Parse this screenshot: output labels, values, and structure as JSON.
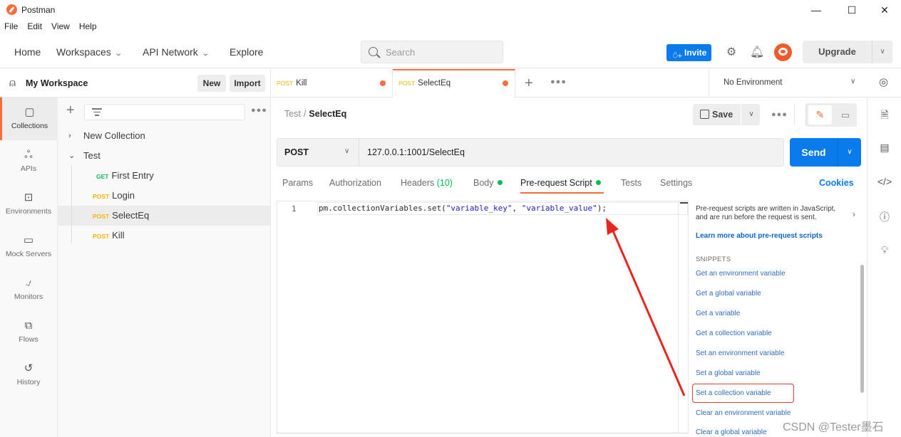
{
  "window": {
    "title": "Postman",
    "controls": {
      "minimize": "—",
      "maximize": "☐",
      "close": "✕"
    }
  },
  "menu": [
    "File",
    "Edit",
    "View",
    "Help"
  ],
  "header": {
    "nav": [
      {
        "label": "Home",
        "has_dropdown": false
      },
      {
        "label": "Workspaces",
        "has_dropdown": true
      },
      {
        "label": "API Network",
        "has_dropdown": true
      },
      {
        "label": "Explore",
        "has_dropdown": false
      }
    ],
    "search_placeholder": "Search",
    "invite_label": "Invite",
    "upgrade_label": "Upgrade",
    "icons": {
      "settings": "⚙",
      "notifications": "🔔"
    }
  },
  "workspace": {
    "name": "My Workspace",
    "new_label": "New",
    "import_label": "Import"
  },
  "rail": [
    {
      "label": "Collections",
      "icon": "collections-icon",
      "glyph": "▢",
      "active": true
    },
    {
      "label": "APIs",
      "icon": "apis-icon",
      "glyph": "ஃ",
      "active": false
    },
    {
      "label": "Environments",
      "icon": "environments-icon",
      "glyph": "⊡",
      "active": false
    },
    {
      "label": "Mock Servers",
      "icon": "mock-servers-icon",
      "glyph": "▭",
      "active": false
    },
    {
      "label": "Monitors",
      "icon": "monitors-icon",
      "glyph": "⍻",
      "active": false
    },
    {
      "label": "Flows",
      "icon": "flows-icon",
      "glyph": "⧉",
      "active": false
    },
    {
      "label": "History",
      "icon": "history-icon",
      "glyph": "↺",
      "active": false
    }
  ],
  "collections": [
    {
      "type": "collection",
      "name": "New Collection",
      "expanded": false
    },
    {
      "type": "collection",
      "name": "Test",
      "expanded": true
    },
    {
      "type": "request",
      "method": "GET",
      "name": "First Entry"
    },
    {
      "type": "request",
      "method": "POST",
      "name": "Login"
    },
    {
      "type": "request",
      "method": "POST",
      "name": "SelectEq",
      "selected": true
    },
    {
      "type": "request",
      "method": "POST",
      "name": "Kill"
    }
  ],
  "tabs": [
    {
      "method": "POST",
      "name": "Kill",
      "unsaved": true,
      "active": false
    },
    {
      "method": "POST",
      "name": "SelectEq",
      "unsaved": true,
      "active": true
    }
  ],
  "environment": {
    "selected": "No Environment"
  },
  "breadcrumb": {
    "parent": "Test",
    "separator": "/",
    "current": "SelectEq"
  },
  "toolbar": {
    "save_label": "Save"
  },
  "request": {
    "method": "POST",
    "url": "127.0.0.1:1001/SelectEq",
    "send_label": "Send"
  },
  "request_tabs": [
    {
      "label": "Params"
    },
    {
      "label": "Authorization"
    },
    {
      "label": "Headers",
      "count": "(10)"
    },
    {
      "label": "Body",
      "indicator": true
    },
    {
      "label": "Pre-request Script",
      "indicator": true,
      "active": true
    },
    {
      "label": "Tests"
    },
    {
      "label": "Settings"
    }
  ],
  "cookies_label": "Cookies",
  "editor": {
    "lines": [
      {
        "number": "1",
        "code_prefix": "pm.collectionVariables.set(",
        "arg1": "\"variable_key\"",
        "sep": ", ",
        "arg2": "\"variable_value\"",
        "code_suffix": ");"
      }
    ]
  },
  "snippets_panel": {
    "description": "Pre-request scripts are written in JavaScript, and are run before the request is sent.",
    "learn_more": "Learn more about pre-request scripts",
    "heading": "SNIPPETS",
    "items": [
      "Get an environment variable",
      "Get a global variable",
      "Get a variable",
      "Get a collection variable",
      "Set an environment variable",
      "Set a global variable",
      "Set a collection variable",
      "Clear an environment variable",
      "Clear a global variable"
    ],
    "highlighted": "Set a collection variable"
  },
  "annotation": {
    "arrow_color": "#e8261f",
    "highlight_color": "#e53935"
  },
  "watermark": "CSDN @Tester墨石",
  "colors": {
    "brand": "#ff6c37",
    "primary": "#097bed",
    "get": "#0cbb52",
    "post": "#ffb400"
  }
}
